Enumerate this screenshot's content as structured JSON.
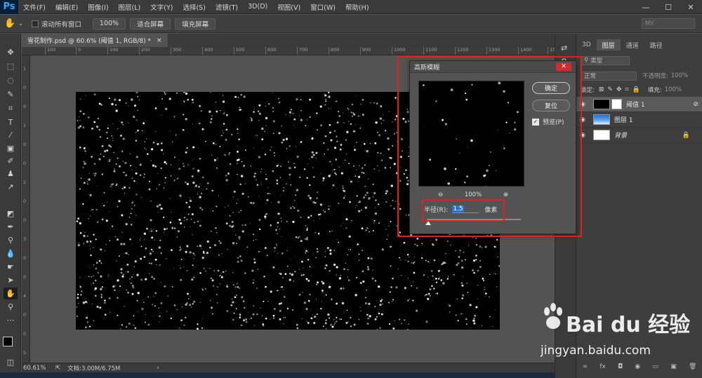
{
  "app": {
    "logo": "Ps",
    "menus": [
      "文件(F)",
      "编辑(E)",
      "图像(I)",
      "图层(L)",
      "文字(Y)",
      "选择(S)",
      "滤镜(T)",
      "3D(D)",
      "视图(V)",
      "窗口(W)",
      "帮助(H)"
    ],
    "window_controls": [
      "—",
      "☐",
      "✕"
    ]
  },
  "options": {
    "scroll_all_label": "滚动所有窗口",
    "zoom_100": "100%",
    "fit_screen": "适合屏幕",
    "fill_screen": "填充屏幕",
    "workspace": "MY"
  },
  "document": {
    "tab_title": "雪花制作.psd @ 60.6% (阈值 1, RGB/8) *",
    "tab_close": "×",
    "ruler_ticks": [
      "100",
      "0",
      "100",
      "200",
      "300",
      "400",
      "500",
      "600",
      "700",
      "800",
      "900",
      "1000",
      "1100",
      "1200",
      "1300",
      "1400",
      "1500"
    ],
    "ruler_left_ticks": [
      "1",
      "0",
      "0",
      "1",
      "0",
      "0",
      "2",
      "0",
      "0",
      "3",
      "0",
      "0",
      "4",
      "0",
      "0",
      "5"
    ],
    "zoom": "60.61%",
    "doc_size": "文档:3.00M/6.75M"
  },
  "dialog": {
    "title": "高斯模糊",
    "close": "✕",
    "ok": "确定",
    "reset": "复位",
    "preview_label": "预览(P)",
    "preview_checked": true,
    "zoom_percent": "100%",
    "zoom_out": "⊖",
    "zoom_in": "⊕",
    "radius_label": "半径(R):",
    "radius_value": "1.5",
    "radius_unit": "像素"
  },
  "layers_panel": {
    "tabs": [
      "3D",
      "图层",
      "通道",
      "路径"
    ],
    "active_tab": "图层",
    "filter_kind": "类型",
    "blend_mode": "正常",
    "opacity_label": "不透明度:",
    "opacity_value": "100%",
    "lock_label": "锁定:",
    "fill_label": "填充:",
    "fill_value": "100%",
    "layers": [
      {
        "name": "阈值 1",
        "active": true
      },
      {
        "name": "图层 1",
        "active": false
      },
      {
        "name": "背景",
        "active": false
      }
    ],
    "footer_icons": [
      "∞",
      "fx",
      "◘",
      "◉",
      "▭",
      "▣",
      "🗑"
    ]
  },
  "watermark": {
    "brand": "Bai du 经验",
    "url": "jingyan.baidu.com"
  },
  "colors": {
    "highlight": "#e02020",
    "ps_blue": "#31a8ff",
    "selection": "#2f6fd6"
  }
}
